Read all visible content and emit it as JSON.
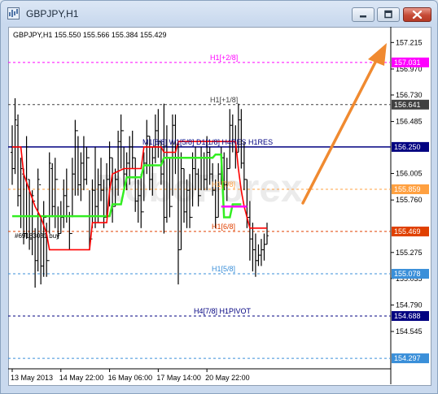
{
  "window": {
    "title": "GBPJPY,H1"
  },
  "chart_data": {
    "type": "bar",
    "symbol_info": "GBPJPY,H1  155.550 155.566 155.384 155.429",
    "order_label": "#69183031 buy",
    "watermark": "RoboForex",
    "ylim": [
      154.2,
      157.36
    ],
    "yticks": [
      "157.215",
      "156.970",
      "156.730",
      "156.485",
      "156.005",
      "155.760",
      "155.275",
      "155.035",
      "154.790",
      "154.545"
    ],
    "xticks": [
      "13 May 2013",
      "14 May 22:00",
      "16 May 06:00",
      "17 May 14:00",
      "20 May 22:00"
    ],
    "levels": [
      {
        "name": "H1[+2/8]",
        "value": 157.031,
        "price": "157.031",
        "color": "#ff00ff",
        "style": "dashed"
      },
      {
        "name": "H1[+1/8]",
        "value": 156.641,
        "price": "156.641",
        "color": "#404040",
        "style": "dashed"
      },
      {
        "name": "M1[8/8] W1[5/8] D1[1/8] H4RES H1RES",
        "value": 156.25,
        "price": "156.250",
        "color": "#000080",
        "style": "solid"
      },
      {
        "name": "H1[7/8]",
        "value": 155.859,
        "price": "155.859",
        "color": "#ffa040",
        "style": "dashed"
      },
      {
        "name": "H1[6/8]",
        "value": 155.469,
        "price": "155.469",
        "color": "#e04000",
        "style": "dashed"
      },
      {
        "name": "H1[5/8]",
        "value": 155.078,
        "price": "155.078",
        "color": "#3a8fd9",
        "style": "dashed"
      },
      {
        "name": "H4[7/8] H1PIVOT",
        "value": 154.688,
        "price": "154.688",
        "color": "#000080",
        "style": "dashed"
      },
      {
        "name": "",
        "value": 154.297,
        "price": "154.297",
        "color": "#3a8fd9",
        "style": "dashed"
      }
    ],
    "current_price": 155.469,
    "bars": [
      [
        156.45,
        155.9,
        156.2,
        156.05
      ],
      [
        156.7,
        156.0,
        156.05,
        156.5
      ],
      [
        156.55,
        155.7,
        156.45,
        155.8
      ],
      [
        156.15,
        155.5,
        155.8,
        156.05
      ],
      [
        156.05,
        155.35,
        156.0,
        155.45
      ],
      [
        156.35,
        155.4,
        155.45,
        156.25
      ],
      [
        155.95,
        155.3,
        155.95,
        155.4
      ],
      [
        155.85,
        155.25,
        155.4,
        155.8
      ],
      [
        155.5,
        154.95,
        155.75,
        155.2
      ],
      [
        156.05,
        155.1,
        155.2,
        155.95
      ],
      [
        155.6,
        154.98,
        155.9,
        155.15
      ],
      [
        155.75,
        155.05,
        155.15,
        155.6
      ],
      [
        155.55,
        155.05,
        155.6,
        155.2
      ],
      [
        156.2,
        155.45,
        155.2,
        156.1
      ],
      [
        156.1,
        155.6,
        156.05,
        155.7
      ],
      [
        156.15,
        155.5,
        155.7,
        155.95
      ],
      [
        155.7,
        155.4,
        155.95,
        155.45
      ],
      [
        155.75,
        155.45,
        155.45,
        155.6
      ],
      [
        155.95,
        155.5,
        155.6,
        155.8
      ],
      [
        156.05,
        155.55,
        155.8,
        155.7
      ],
      [
        155.65,
        155.3,
        155.7,
        155.45
      ],
      [
        156.15,
        155.6,
        155.45,
        156.0
      ],
      [
        156.5,
        155.8,
        156.0,
        156.4
      ],
      [
        156.35,
        155.8,
        156.4,
        155.9
      ],
      [
        156.2,
        155.75,
        155.9,
        156.1
      ],
      [
        156.35,
        155.85,
        156.1,
        155.95
      ],
      [
        156.25,
        155.9,
        155.95,
        156.15
      ],
      [
        155.85,
        155.3,
        156.15,
        155.4
      ],
      [
        155.95,
        155.5,
        155.4,
        155.85
      ],
      [
        156.25,
        155.5,
        155.85,
        155.7
      ],
      [
        156.05,
        155.55,
        155.7,
        155.9
      ],
      [
        156.15,
        155.75,
        155.9,
        155.85
      ],
      [
        155.95,
        155.5,
        155.85,
        155.6
      ],
      [
        156.1,
        155.6,
        155.6,
        155.95
      ],
      [
        156.3,
        155.7,
        155.95,
        156.15
      ],
      [
        156.15,
        155.55,
        156.15,
        155.7
      ],
      [
        156.05,
        155.7,
        155.7,
        155.95
      ],
      [
        156.4,
        155.8,
        155.95,
        156.3
      ],
      [
        156.55,
        156.05,
        156.3,
        156.4
      ],
      [
        156.25,
        155.85,
        156.4,
        156.0
      ],
      [
        156.2,
        155.85,
        156.0,
        156.1
      ],
      [
        156.35,
        155.9,
        156.1,
        156.25
      ],
      [
        156.4,
        156.05,
        156.25,
        156.15
      ],
      [
        156.15,
        155.65,
        156.15,
        155.75
      ],
      [
        155.95,
        155.55,
        155.75,
        155.8
      ],
      [
        156.0,
        155.5,
        155.8,
        155.65
      ],
      [
        156.2,
        155.75,
        155.65,
        156.1
      ],
      [
        156.5,
        156.0,
        156.1,
        156.35
      ],
      [
        156.35,
        155.85,
        156.35,
        155.95
      ],
      [
        156.25,
        155.8,
        155.95,
        156.15
      ],
      [
        156.55,
        156.1,
        156.15,
        156.4
      ],
      [
        156.6,
        156.15,
        156.4,
        156.3
      ],
      [
        156.3,
        155.9,
        156.3,
        156.0
      ],
      [
        156.65,
        155.45,
        156.0,
        155.6
      ],
      [
        156.45,
        155.55,
        155.6,
        156.2
      ],
      [
        156.15,
        155.6,
        156.2,
        155.7
      ],
      [
        156.55,
        155.8,
        155.7,
        156.45
      ],
      [
        156.55,
        156.0,
        156.45,
        156.15
      ],
      [
        156.3,
        154.98,
        156.15,
        155.3
      ],
      [
        156.2,
        155.3,
        155.3,
        156.05
      ],
      [
        156.05,
        155.55,
        156.05,
        155.65
      ],
      [
        155.95,
        155.5,
        155.65,
        155.85
      ],
      [
        156.0,
        155.5,
        155.85,
        155.6
      ],
      [
        156.2,
        155.7,
        155.6,
        156.05
      ],
      [
        156.25,
        155.85,
        156.05,
        156.0
      ],
      [
        156.05,
        155.7,
        156.0,
        155.8
      ],
      [
        156.25,
        155.85,
        155.8,
        156.15
      ],
      [
        156.2,
        155.85,
        156.15,
        155.95
      ],
      [
        156.35,
        155.85,
        155.95,
        156.2
      ],
      [
        156.25,
        155.9,
        156.2,
        156.0
      ],
      [
        156.1,
        155.8,
        156.0,
        155.85
      ],
      [
        155.95,
        155.5,
        155.85,
        155.6
      ],
      [
        156.1,
        155.6,
        155.6,
        156.0
      ],
      [
        156.25,
        155.9,
        156.0,
        156.15
      ],
      [
        156.2,
        155.85,
        156.15,
        155.9
      ],
      [
        156.15,
        155.75,
        155.9,
        156.05
      ],
      [
        156.6,
        156.05,
        156.05,
        156.45
      ],
      [
        156.55,
        156.2,
        156.45,
        156.3
      ],
      [
        156.45,
        156.05,
        156.3,
        156.2
      ],
      [
        156.65,
        156.2,
        156.2,
        156.5
      ],
      [
        156.6,
        156.05,
        156.5,
        156.1
      ],
      [
        156.3,
        155.85,
        156.1,
        155.95
      ],
      [
        155.95,
        155.5,
        155.95,
        155.6
      ],
      [
        155.75,
        155.2,
        155.6,
        155.4
      ],
      [
        155.55,
        155.1,
        155.4,
        155.3
      ],
      [
        155.45,
        155.05,
        155.3,
        155.2
      ],
      [
        155.35,
        155.15,
        155.2,
        155.25
      ],
      [
        155.4,
        155.15,
        155.25,
        155.3
      ],
      [
        155.45,
        155.2,
        155.3,
        155.35
      ],
      [
        155.55,
        155.35,
        155.35,
        155.43
      ]
    ],
    "red_line": [
      [
        0,
        156.25
      ],
      [
        3,
        156.25
      ],
      [
        4,
        156.0
      ],
      [
        6,
        155.85
      ],
      [
        8,
        155.7
      ],
      [
        10,
        155.6
      ],
      [
        12,
        155.45
      ],
      [
        13,
        155.3
      ],
      [
        27,
        155.3
      ],
      [
        28,
        155.55
      ],
      [
        33,
        155.55
      ],
      [
        34,
        155.85
      ],
      [
        35,
        156.0
      ],
      [
        39,
        156.05
      ],
      [
        45,
        156.05
      ],
      [
        46,
        156.25
      ],
      [
        52,
        156.25
      ],
      [
        53,
        156.2
      ],
      [
        57,
        156.2
      ],
      [
        58,
        156.3
      ],
      [
        78,
        156.3
      ],
      [
        79,
        156.05
      ],
      [
        80,
        155.85
      ],
      [
        81,
        155.7
      ],
      [
        82,
        155.6
      ],
      [
        83,
        155.5
      ],
      [
        89,
        155.5
      ]
    ],
    "green_line": [
      [
        0,
        155.61
      ],
      [
        34,
        155.61
      ],
      [
        35,
        155.72
      ],
      [
        38,
        155.72
      ],
      [
        39,
        155.85
      ],
      [
        40,
        155.97
      ],
      [
        45,
        155.97
      ],
      [
        46,
        156.08
      ],
      [
        52,
        156.08
      ],
      [
        53,
        156.15
      ],
      [
        70,
        156.15
      ],
      [
        71,
        156.18
      ],
      [
        73,
        156.18
      ],
      [
        74,
        155.6
      ],
      [
        76,
        155.6
      ],
      [
        77,
        155.72
      ],
      [
        80,
        155.72
      ]
    ],
    "magenta_line": [
      [
        73,
        155.7
      ],
      [
        82,
        155.7
      ]
    ]
  }
}
